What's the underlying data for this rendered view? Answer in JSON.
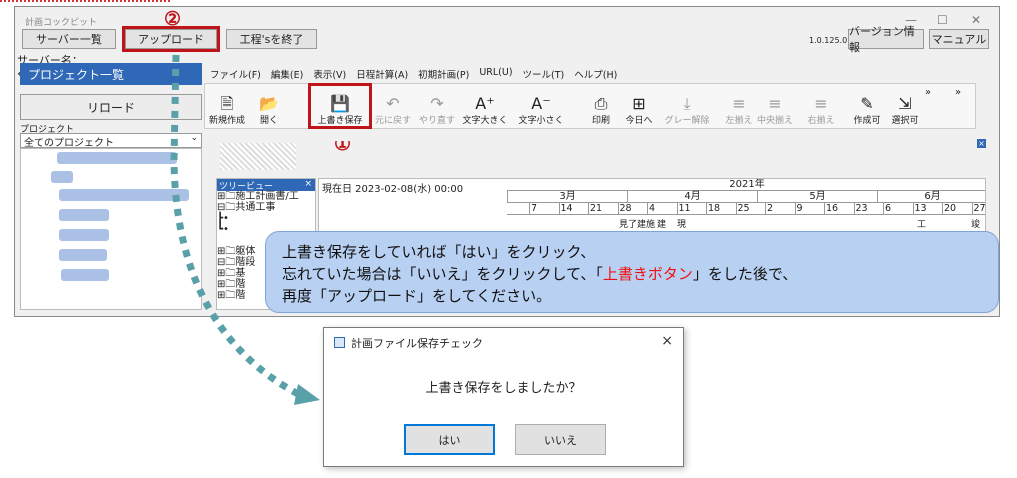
{
  "app": {
    "title": "計画コックピット",
    "version": "1.0.125.0"
  },
  "toolbar": {
    "server_list": "サーバー一覧",
    "upload": "アップロード",
    "finish": "工程'sを終了",
    "version_info": "バージョン情報",
    "manual": "マニュアル"
  },
  "sidebar": {
    "server_name_label": "サーバー名：",
    "project_list_header": "プロジェクト一覧",
    "reload": "リロード",
    "project_label": "プロジェクト",
    "project_select": "全てのプロジェクト"
  },
  "menu": [
    "ファイル(F)",
    "編集(E)",
    "表示(V)",
    "日程計算(A)",
    "初期計画(P)",
    "URL(U)",
    "ツール(T)",
    "ヘルプ(H)"
  ],
  "ribbon": [
    {
      "label": "新規作成",
      "icon": "new-file-icon",
      "glyph": "🗎"
    },
    {
      "label": "開く",
      "icon": "open-folder-icon",
      "glyph": "📂"
    },
    {
      "label": "上書き保存",
      "icon": "save-icon",
      "glyph": "💾"
    },
    {
      "label": "元に戻す",
      "icon": "undo-icon",
      "glyph": "↶"
    },
    {
      "label": "やり直す",
      "icon": "redo-icon",
      "glyph": "↷"
    },
    {
      "label": "文字大きく",
      "icon": "font-larger-icon",
      "glyph": "A⁺"
    },
    {
      "label": "文字小さく",
      "icon": "font-smaller-icon",
      "glyph": "A⁻"
    },
    {
      "label": "印刷",
      "icon": "print-icon",
      "glyph": "⎙"
    },
    {
      "label": "今日へ",
      "icon": "today-icon",
      "glyph": "⊞"
    },
    {
      "label": "グレー解除",
      "icon": "gray-clear-icon",
      "glyph": "⤓"
    },
    {
      "label": "左揃え",
      "icon": "align-left-icon",
      "glyph": "≡"
    },
    {
      "label": "中央揃え",
      "icon": "align-center-icon",
      "glyph": "≡"
    },
    {
      "label": "右揃え",
      "icon": "align-right-icon",
      "glyph": "≡"
    },
    {
      "label": "作成可",
      "icon": "create-enabled-icon",
      "glyph": "✎"
    },
    {
      "label": "選択可",
      "icon": "select-enabled-icon",
      "glyph": "⇲"
    }
  ],
  "annotations": {
    "num1": "①",
    "num2": "②"
  },
  "treeview": {
    "header": "ツリービュー",
    "close": "×",
    "items": [
      "⊞🗀施工計画書/工",
      "⊟🗀共通工事",
      "   ┣•",
      "   ┗•",
      "",
      "⊞🗀躯体",
      "⊟🗀階段",
      " ⊞🗀基",
      " ⊞🗀階",
      " ⊞🗀階"
    ]
  },
  "gantt": {
    "current_date": "現在日 2023-02-08(水) 00:00",
    "year": "2021年",
    "months": [
      "3月",
      "4月",
      "5月",
      "6月"
    ],
    "days": [
      "7",
      "14",
      "21",
      "28",
      "4",
      "11",
      "18",
      "25",
      "2",
      "9",
      "16",
      "23",
      "6",
      "13",
      "20",
      "27"
    ],
    "labels": [
      "見了",
      "建施",
      "建",
      "現",
      "工",
      "竣"
    ]
  },
  "bubble": {
    "line1": "上書き保存をしていれば「はい」をクリック、",
    "line2_a": "忘れていた場合は「いいえ」をクリックして、「",
    "line2_red": "上書きボタン",
    "line2_b": "」をした後で、",
    "line3": "再度「アップロード」をしてください。"
  },
  "dialog": {
    "title": "計画ファイル保存チェック",
    "message": "上書き保存をしましたか？",
    "yes": "はい",
    "no": "いいえ",
    "close": "×"
  },
  "colors": {
    "accent": "#2e68b6",
    "highlight": "#c0141b",
    "bubble": "#b8d0f2",
    "arrow": "#5aa0a8"
  }
}
